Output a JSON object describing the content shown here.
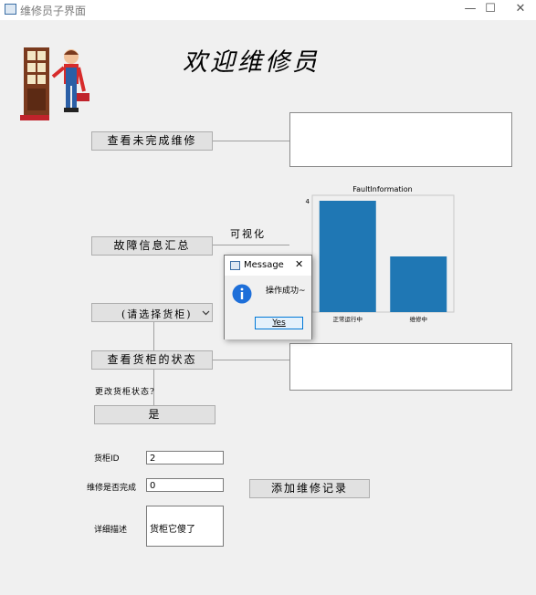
{
  "window": {
    "title": "维修员子界面",
    "minimize": "—",
    "maximize": "☐",
    "close": "✕"
  },
  "header": {
    "welcome": "欢迎维修员"
  },
  "buttons": {
    "view_unfinished": "查看未完成维修",
    "fault_summary": "故障信息汇总",
    "view_cabinet_status": "查看货柜的状态",
    "confirm_yes": "是",
    "add_record": "添加维修记录"
  },
  "labels": {
    "visualize": "可视化",
    "change_status_prompt": "更改货柜状态?",
    "cabinet_id": "货柜ID",
    "repair_done": "维修是否完成",
    "detail": "详细描述"
  },
  "select": {
    "cabinet": "(请选择货柜)"
  },
  "inputs": {
    "cabinet_id": "2",
    "repair_done": "0",
    "detail": "货柜它傻了"
  },
  "dialog": {
    "title": "Message",
    "message": "操作成功~",
    "ok": "Yes",
    "close": "✕"
  },
  "icons": {
    "info": "info-icon",
    "repairman": "repairman-illustration",
    "door": "door-icon"
  },
  "colors": {
    "bar": "#1f77b4",
    "info": "#1e6fd9"
  },
  "chart_data": {
    "type": "bar",
    "title": "FaultInformation",
    "categories": [
      "正常运行中",
      "维修中"
    ],
    "values": [
      4,
      2
    ],
    "ylim": [
      0,
      4
    ],
    "yticks": [
      "4",
      "2"
    ]
  }
}
